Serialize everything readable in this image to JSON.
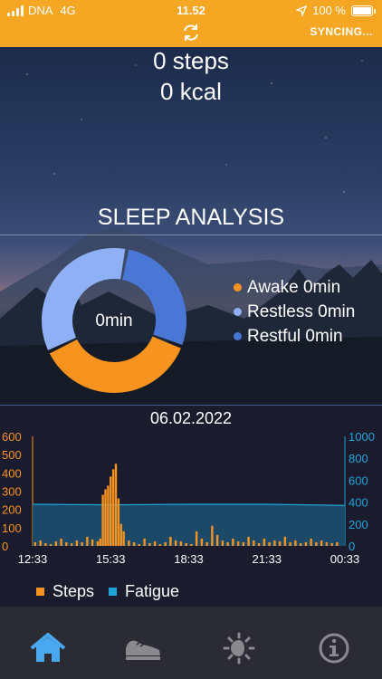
{
  "status_bar": {
    "carrier": "DNA",
    "network": "4G",
    "time": "11.52",
    "battery_percent": "100 %",
    "battery_level": 1.0,
    "sync_label": "SYNCING..."
  },
  "summary": {
    "steps": "0 steps",
    "kcal": "0 kcal"
  },
  "sleep": {
    "title": "SLEEP ANALYSIS",
    "center_label": "0min",
    "legend": [
      {
        "label": "Awake 0min",
        "color": "#f7931e"
      },
      {
        "label": "Restless 0min",
        "color": "#8fb0f5"
      },
      {
        "label": "Restful 0min",
        "color": "#4a76d6"
      }
    ],
    "segments": [
      {
        "name": "Restful",
        "fraction": 0.28,
        "color": "#4a76d6"
      },
      {
        "name": "Awake",
        "fraction": 0.37,
        "color": "#f7931e"
      },
      {
        "name": "Restless",
        "fraction": 0.35,
        "color": "#8fb0f5"
      }
    ]
  },
  "chart": {
    "date": "06.02.2022",
    "legend": [
      {
        "label": "Steps",
        "color": "#f7931e"
      },
      {
        "label": "Fatigue",
        "color": "#1fa3d8"
      }
    ]
  },
  "chart_data": {
    "type": "bar",
    "x_ticks": [
      "12:33",
      "15:33",
      "18:33",
      "21:33",
      "00:33"
    ],
    "left_axis": {
      "ticks": [
        "0",
        "100",
        "200",
        "300",
        "400",
        "500",
        "600"
      ],
      "ylim": [
        0,
        600
      ],
      "color": "#f7931e"
    },
    "right_axis": {
      "ticks": [
        "0",
        "200",
        "400",
        "600",
        "800",
        "1000"
      ],
      "ylim": [
        0,
        1000
      ],
      "color": "#1fa3d8"
    },
    "xlim_hours": [
      0,
      12
    ],
    "series": [
      {
        "name": "Steps",
        "type": "bar",
        "color": "#f7931e",
        "x_hours": [
          0.1,
          0.3,
          0.5,
          0.7,
          0.9,
          1.1,
          1.3,
          1.5,
          1.7,
          1.9,
          2.1,
          2.3,
          2.5,
          2.6,
          2.7,
          2.8,
          2.9,
          3.0,
          3.1,
          3.2,
          3.3,
          3.4,
          3.5,
          3.7,
          3.9,
          4.1,
          4.3,
          4.5,
          4.7,
          4.9,
          5.1,
          5.3,
          5.5,
          5.7,
          5.9,
          6.1,
          6.3,
          6.5,
          6.7,
          6.9,
          7.1,
          7.3,
          7.5,
          7.7,
          7.9,
          8.1,
          8.3,
          8.5,
          8.7,
          8.9,
          9.1,
          9.3,
          9.5,
          9.7,
          9.9,
          10.1,
          10.3,
          10.5,
          10.7,
          10.9,
          11.1,
          11.3,
          11.5,
          11.7
        ],
        "values": [
          20,
          30,
          15,
          10,
          25,
          40,
          20,
          15,
          30,
          20,
          50,
          35,
          25,
          40,
          280,
          310,
          330,
          380,
          420,
          450,
          260,
          120,
          80,
          30,
          20,
          10,
          40,
          15,
          25,
          10,
          20,
          50,
          30,
          25,
          15,
          10,
          80,
          40,
          20,
          110,
          60,
          30,
          20,
          40,
          25,
          20,
          50,
          30,
          15,
          40,
          20,
          30,
          25,
          50,
          20,
          30,
          15,
          20,
          40,
          20,
          30,
          20,
          15,
          20
        ]
      },
      {
        "name": "Fatigue",
        "type": "area",
        "color": "#1fa3d8",
        "x_hours": [
          0,
          3,
          6,
          9,
          12
        ],
        "values": [
          380,
          375,
          380,
          380,
          370
        ]
      }
    ]
  },
  "tabs": [
    {
      "name": "home",
      "icon": "home-icon",
      "active": true
    },
    {
      "name": "activity",
      "icon": "shoe-icon",
      "active": false
    },
    {
      "name": "sleep",
      "icon": "sun-moon-icon",
      "active": false
    },
    {
      "name": "info",
      "icon": "info-icon",
      "active": false
    }
  ]
}
